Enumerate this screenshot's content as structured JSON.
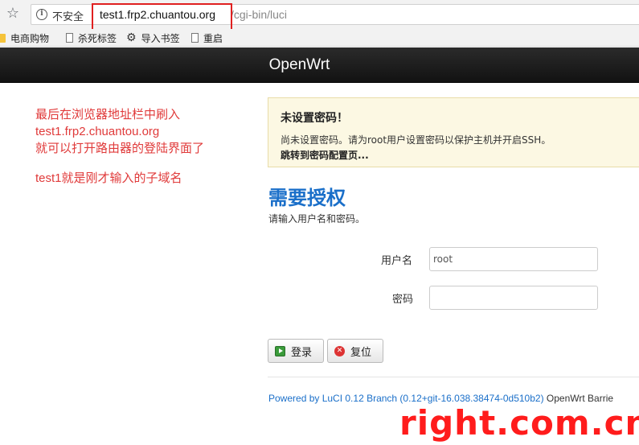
{
  "browser": {
    "security_label": "不安全",
    "url_host": "test1.frp2.chuantou.org",
    "url_path": "/cgi-bin/luci",
    "bookmarks": [
      "电商购物",
      "杀死标签",
      "导入书签",
      "重启"
    ]
  },
  "header": {
    "brand": "OpenWrt"
  },
  "annotation": {
    "lines": [
      "最后在浏览器地址栏中刷入",
      "test1.frp2.chuantou.org",
      "就可以打开路由器的登陆界面了"
    ],
    "note": "test1就是刚才输入的子域名"
  },
  "alert": {
    "title": "未设置密码！",
    "text": "尚未设置密码。请为root用户设置密码以保护主机并开启SSH。",
    "link": "跳转到密码配置页..."
  },
  "auth": {
    "title": "需要授权",
    "subtitle": "请输入用户名和密码。",
    "username_label": "用户名",
    "username_value": "root",
    "password_label": "密码",
    "login_button": "登录",
    "reset_button": "复位"
  },
  "footer": {
    "link": "Powered by LuCI 0.12 Branch (0.12+git-16.038.38474-0d510b2)",
    "text": "OpenWrt Barrie"
  },
  "watermark": "right.com.cn",
  "colors": {
    "accent": "#1a6fc9",
    "annotation": "#e03a3a",
    "watermark": "#ff1c1c"
  }
}
